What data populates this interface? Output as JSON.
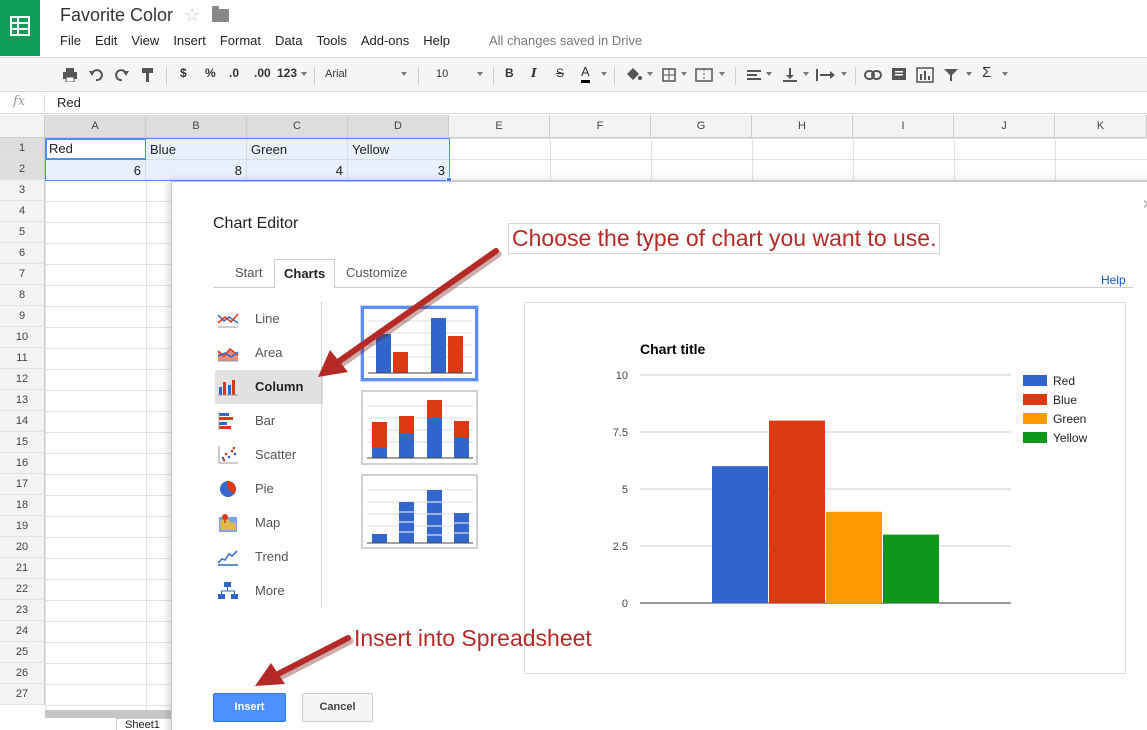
{
  "app": {
    "document_title": "Favorite Color",
    "menu": [
      "File",
      "Edit",
      "View",
      "Insert",
      "Format",
      "Data",
      "Tools",
      "Add-ons",
      "Help"
    ],
    "save_status": "All changes saved in Drive",
    "icons": [
      "sheets-logo-icon",
      "star-icon",
      "folder-icon"
    ]
  },
  "toolbar": {
    "currency": "$",
    "percent": "%",
    "decimal_decrease": ".0",
    "decimal_increase": ".00",
    "number_format": "123",
    "font_family": "Arial",
    "font_size": "10",
    "bold": "B",
    "italic": "I",
    "strike": "S",
    "text_color": "A",
    "sum": "Σ"
  },
  "formula_bar": {
    "fx_label": "fx",
    "value": "Red"
  },
  "grid": {
    "columns": [
      "A",
      "B",
      "C",
      "D",
      "E",
      "F",
      "G",
      "H",
      "I",
      "J",
      "K"
    ],
    "rows": [
      "1",
      "2",
      "3",
      "4",
      "5",
      "6",
      "7",
      "8",
      "9",
      "10",
      "11",
      "12",
      "13",
      "14",
      "15",
      "16",
      "17",
      "18",
      "19",
      "20",
      "21",
      "22",
      "23",
      "24",
      "25",
      "26",
      "27"
    ],
    "cells": {
      "A1": "Red",
      "B1": "Blue",
      "C1": "Green",
      "D1": "Yellow",
      "A2": "6",
      "B2": "8",
      "C2": "4",
      "D2": "3"
    },
    "sheet_tab": "Sheet1"
  },
  "chart_editor": {
    "title": "Chart Editor",
    "tabs": [
      "Start",
      "Charts",
      "Customize"
    ],
    "active_tab": "Charts",
    "help": "Help",
    "chart_types": [
      "Line",
      "Area",
      "Column",
      "Bar",
      "Scatter",
      "Pie",
      "Map",
      "Trend",
      "More"
    ],
    "selected_type": "Column",
    "insert_label": "Insert",
    "cancel_label": "Cancel"
  },
  "annotations": {
    "top": "Choose the type of chart you want to use.",
    "bottom": "Insert into Spreadsheet",
    "color": "#b52a27"
  },
  "chart_data": {
    "type": "bar",
    "title": "Chart title",
    "categories": [
      ""
    ],
    "series": [
      {
        "name": "Red",
        "values": [
          6
        ],
        "color": "#3366cc"
      },
      {
        "name": "Blue",
        "values": [
          8
        ],
        "color": "#dc3912"
      },
      {
        "name": "Green",
        "values": [
          4
        ],
        "color": "#ff9900"
      },
      {
        "name": "Yellow",
        "values": [
          3
        ],
        "color": "#109618"
      }
    ],
    "ylim": [
      0,
      10
    ],
    "yticks": [
      "0",
      "2.5",
      "5",
      "7.5",
      "10"
    ],
    "grid": true,
    "legend": "right"
  }
}
